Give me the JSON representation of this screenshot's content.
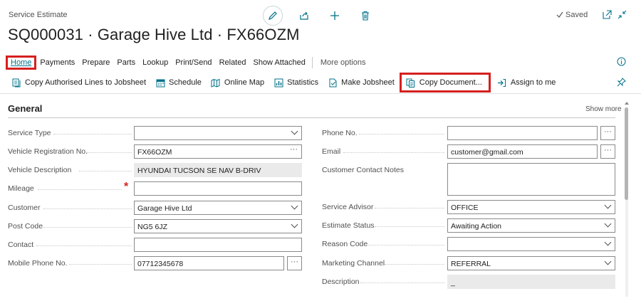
{
  "page": {
    "type": "Service Estimate",
    "title": "SQ000031 · Garage Hive Ltd · FX66OZM",
    "saved_label": "Saved"
  },
  "nav": {
    "items": [
      "Home",
      "Payments",
      "Prepare",
      "Parts",
      "Lookup",
      "Print/Send",
      "Related",
      "Show Attached"
    ],
    "more": "More options"
  },
  "actions": [
    {
      "label": "Copy Authorised Lines to Jobsheet",
      "icon": "copy-lines-icon"
    },
    {
      "label": "Schedule",
      "icon": "schedule-icon"
    },
    {
      "label": "Online Map",
      "icon": "map-icon"
    },
    {
      "label": "Statistics",
      "icon": "statistics-icon"
    },
    {
      "label": "Make Jobsheet",
      "icon": "make-jobsheet-icon"
    },
    {
      "label": "Copy Document...",
      "icon": "copy-document-icon"
    },
    {
      "label": "Assign to me",
      "icon": "assign-icon"
    }
  ],
  "section": {
    "title": "General",
    "show_more": "Show more"
  },
  "left_fields": [
    {
      "label": "Service Type",
      "value": ""
    },
    {
      "label": "Vehicle Registration No.",
      "value": "FX66OZM"
    },
    {
      "label": "Vehicle Description",
      "value": "HYUNDAI TUCSON SE NAV B-DRIV"
    },
    {
      "label": "Mileage",
      "value": ""
    },
    {
      "label": "Customer",
      "value": "Garage Hive Ltd"
    },
    {
      "label": "Post Code",
      "value": "NG5 6JZ"
    },
    {
      "label": "Contact",
      "value": ""
    },
    {
      "label": "Mobile Phone No.",
      "value": "07712345678"
    }
  ],
  "right_fields": [
    {
      "label": "Phone No.",
      "value": ""
    },
    {
      "label": "Email",
      "value": "customer@gmail.com"
    },
    {
      "label": "Customer Contact Notes",
      "value": ""
    },
    {
      "label": "Service Advisor",
      "value": "OFFICE"
    },
    {
      "label": "Estimate Status",
      "value": "Awaiting Action"
    },
    {
      "label": "Reason Code",
      "value": ""
    },
    {
      "label": "Marketing Channel",
      "value": "REFERRAL"
    },
    {
      "label": "Description",
      "value": "_"
    }
  ],
  "colors": {
    "accent": "#00718a",
    "highlight": "#d61f1f"
  }
}
